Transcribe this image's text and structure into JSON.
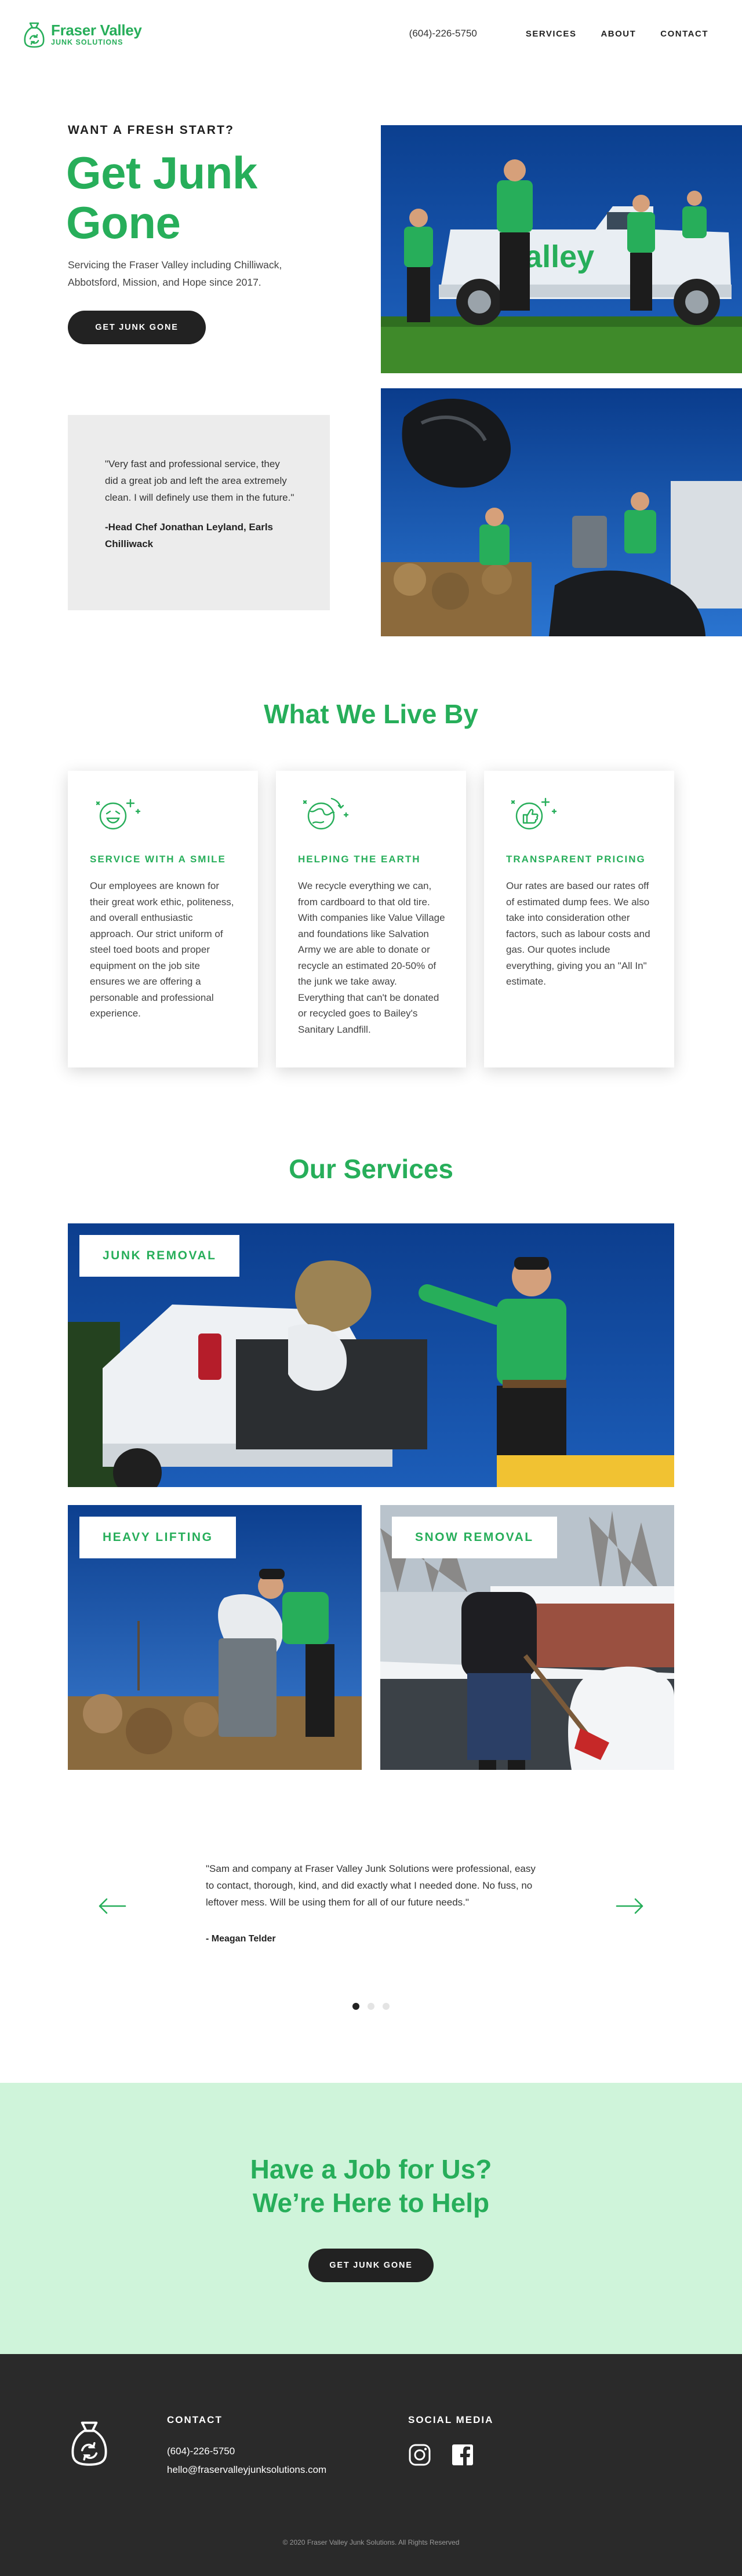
{
  "header": {
    "logo_name": "Fraser Valley",
    "logo_sub": "JUNK SOLUTIONS",
    "phone": "(604)-226-5750",
    "nav": [
      {
        "label": "SERVICES"
      },
      {
        "label": "ABOUT"
      },
      {
        "label": "CONTACT"
      }
    ]
  },
  "hero": {
    "kicker": "WANT A FRESH START?",
    "title": "Get Junk Gone",
    "description": "Servicing the Fraser Valley including Chilliwack, Abbotsford, Mission, and Hope since 2017.",
    "button_label": "GET JUNK GONE",
    "truck_lettering": "Valley"
  },
  "hero_quote": {
    "text": "\"Very fast and professional service, they did a great job and left the area extremely clean. I will definely use them in the future.\"",
    "author": "-Head Chef Jonathan Leyland, Earls Chilliwack"
  },
  "values": {
    "title": "What We Live By",
    "cards": [
      {
        "icon": "smile-icon",
        "title": "SERVICE WITH A SMILE",
        "text": "Our employees are known for their great work ethic, politeness, and overall enthusiastic approach. Our strict uniform of steel toed boots and proper equipment on the job site ensures we are offering a personable and professional experience."
      },
      {
        "icon": "earth-icon",
        "title": "HELPING THE EARTH",
        "text": "We recycle everything we can, from cardboard to that old tire. With companies like Value Village and foundations like Salvation Army we are able to donate or recycle an estimated 20-50% of the junk we take away. Everything that can't be donated or recycled goes to Bailey's Sanitary Landfill."
      },
      {
        "icon": "thumbs-up-icon",
        "title": "TRANSPARENT PRICING",
        "text": "Our rates are based our rates off of estimated dump fees. We also take into consideration other factors, such as labour costs and gas. Our quotes include everything, giving you an \"All In\" estimate."
      }
    ]
  },
  "services": {
    "title": "Our Services",
    "items": [
      {
        "label": "JUNK REMOVAL"
      },
      {
        "label": "HEAVY LIFTING"
      },
      {
        "label": "SNOW REMOVAL"
      }
    ]
  },
  "testimonial": {
    "quote": "\"Sam and company at Fraser Valley Junk Solutions were professional, easy to contact, thorough, kind, and did exactly what I needed done. No fuss, no leftover mess. Will be using them for all of our future needs.\"",
    "author": "- Meagan Telder",
    "active_slide": 1,
    "slide_count": 3
  },
  "cta": {
    "title_line1": "Have a Job for Us?",
    "title_line2": "We’re Here to Help",
    "button_label": "GET JUNK GONE"
  },
  "footer": {
    "contact_heading": "CONTACT",
    "phone": "(604)-226-5750",
    "email": "hello@fraservalleyjunksolutions.com",
    "social_heading": "SOCIAL MEDIA",
    "social": [
      "instagram-icon",
      "facebook-icon"
    ],
    "copyright": "© 2020 Fraser Valley Junk Solutions. All Rights Reserved"
  },
  "colors": {
    "brand_green": "#27ae5a",
    "cta_background": "#cff4da",
    "dark": "#222222",
    "footer_background": "#2a2a2a"
  }
}
